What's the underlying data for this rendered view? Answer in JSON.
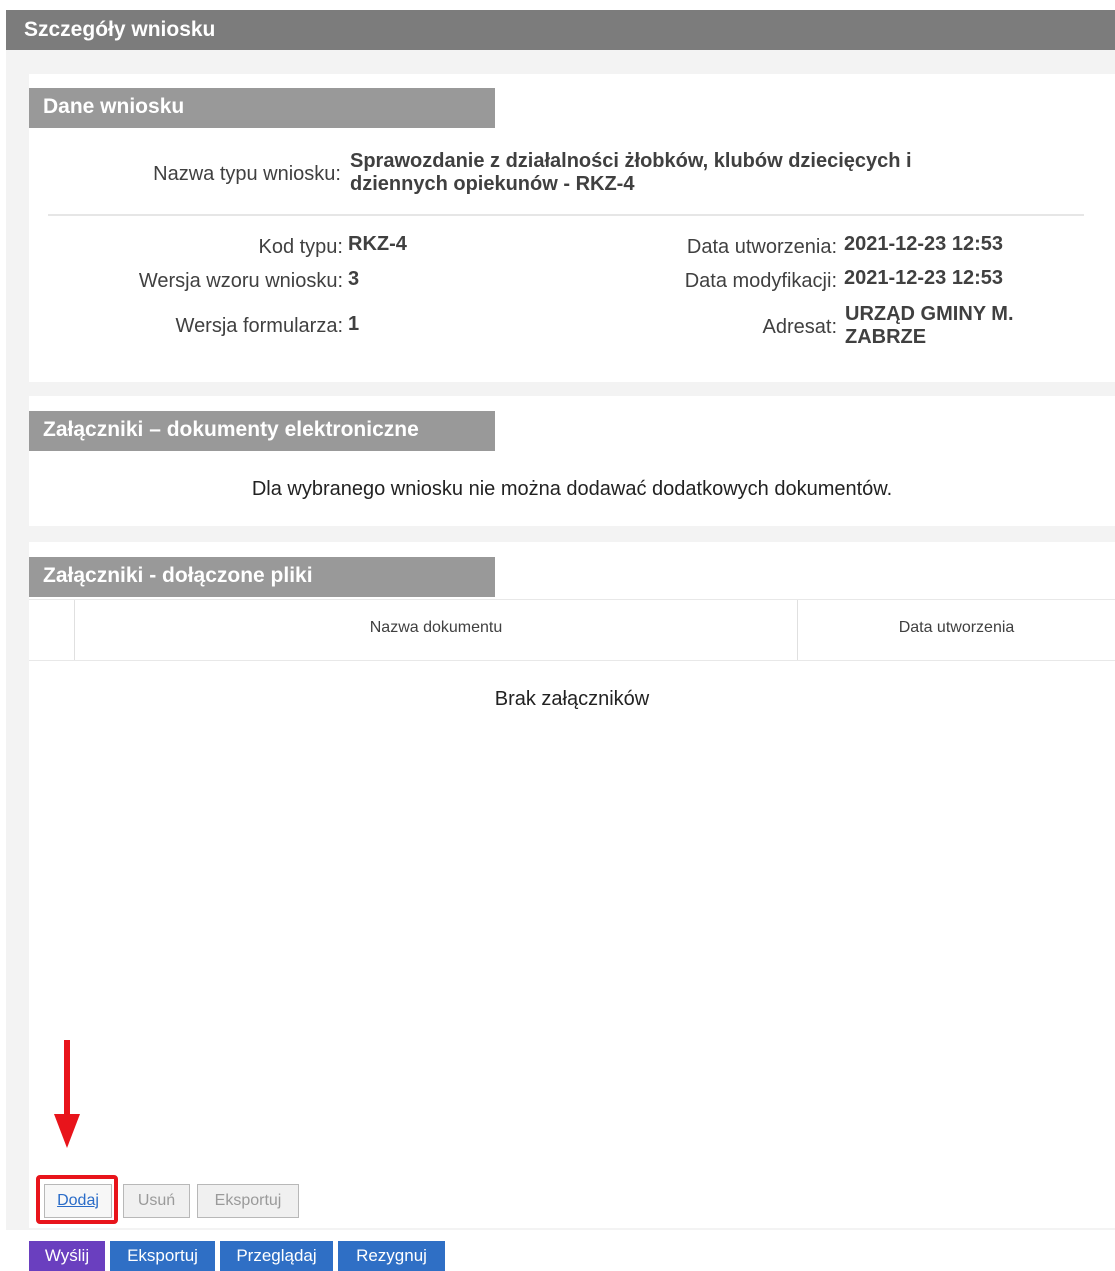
{
  "header": {
    "title": "Szczegóły wniosku"
  },
  "dane": {
    "title": "Dane wniosku",
    "nazwa_label": "Nazwa typu wniosku:",
    "nazwa_value_line1": "Sprawozdanie z działalności żłobków, klubów dziecięcych i",
    "nazwa_value_line2": "dziennych opiekunów - RKZ-4",
    "kod_label": "Kod typu:",
    "kod_value": "RKZ-4",
    "wersja_wzoru_label": "Wersja wzoru wniosku:",
    "wersja_wzoru_value": "3",
    "wersja_formularza_label": "Wersja formularza:",
    "wersja_formularza_value": "1",
    "data_utworzenia_label": "Data utworzenia:",
    "data_utworzenia_value": "2021-12-23 12:53",
    "data_modyfikacji_label": "Data modyfikacji:",
    "data_modyfikacji_value": "2021-12-23 12:53",
    "adresat_label": "Adresat:",
    "adresat_value_line1": "URZĄD GMINY M.",
    "adresat_value_line2": "ZABRZE"
  },
  "dokumenty": {
    "title": "Załączniki – dokumenty elektroniczne",
    "info": "Dla wybranego wniosku nie można dodawać dodatkowych dokumentów."
  },
  "pliki": {
    "title": "Załączniki - dołączone pliki",
    "columns": [
      "Nazwa dokumentu",
      "Data utworzenia"
    ],
    "empty": "Brak załączników",
    "buttons": {
      "add": "Dodaj",
      "remove": "Usuń",
      "export": "Eksportuj"
    }
  },
  "actions": {
    "send": "Wyślij",
    "export": "Eksportuj",
    "browse": "Przeglądaj",
    "cancel": "Rezygnuj"
  },
  "colors": {
    "header_bg": "#7c7c7c",
    "section_header_bg": "#999999",
    "send_bg": "#6a3fbf",
    "action_bg": "#2f6fc5",
    "highlight": "#e8141b"
  }
}
